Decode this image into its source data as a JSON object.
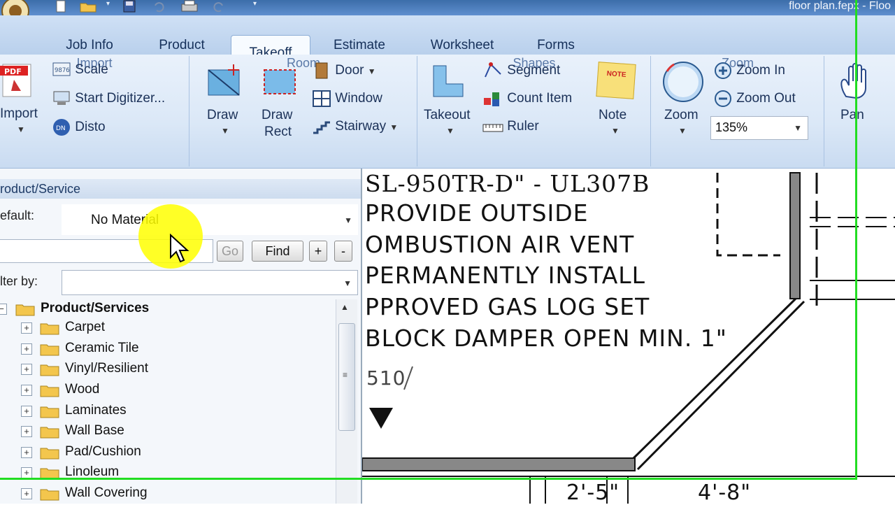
{
  "window": {
    "title": "floor plan.fepx - Floo"
  },
  "tabs": [
    {
      "label": "Job Info"
    },
    {
      "label": "Product"
    },
    {
      "label": "Takeoff"
    },
    {
      "label": "Estimate"
    },
    {
      "label": "Worksheet"
    },
    {
      "label": "Forms"
    }
  ],
  "ribbon": {
    "import_group": {
      "label": "Import",
      "import_button": "Import",
      "scale": "Scale",
      "start_digitizer": "Start Digitizer...",
      "disto": "Disto"
    },
    "room_group": {
      "label": "Room",
      "draw": "Draw",
      "draw_rect_line1": "Draw",
      "draw_rect_line2": "Rect",
      "door": "Door",
      "window": "Window",
      "stairway": "Stairway"
    },
    "shapes_group": {
      "label": "Shapes",
      "takeout": "Takeout",
      "segment": "Segment",
      "count_item": "Count Item",
      "ruler": "Ruler",
      "note": "Note",
      "note_icon_text": "NOTE"
    },
    "zoom_group": {
      "label": "Zoom",
      "zoom": "Zoom",
      "zoom_in": "Zoom In",
      "zoom_out": "Zoom Out",
      "zoom_level": "135%"
    },
    "pan_group": {
      "pan": "Pan"
    }
  },
  "left_panel": {
    "header": "roduct/Service",
    "default_label": "efault:",
    "default_value": "No Material",
    "go_button": "Go",
    "find_button": "Find",
    "add_button": "+",
    "remove_button": "-",
    "filter_label": "lter by:",
    "tree_root": "Product/Services",
    "tree_items": [
      {
        "label": "Carpet"
      },
      {
        "label": "Ceramic Tile"
      },
      {
        "label": "Vinyl/Resilient"
      },
      {
        "label": "Wood"
      },
      {
        "label": "Laminates"
      },
      {
        "label": "Wall Base"
      },
      {
        "label": "Pad/Cushion"
      },
      {
        "label": "Linoleum"
      },
      {
        "label": "Wall Covering"
      }
    ]
  },
  "canvas": {
    "lines": [
      "SL-950TR-D\" - UL307B",
      "PROVIDE OUTSIDE",
      "OMBUSTION AIR VENT",
      "PERMANENTLY INSTALL",
      "PPROVED GAS LOG SET",
      "BLOCK DAMPER OPEN MIN. 1\""
    ],
    "ref_tag": "510",
    "dim_1": "2'-5\"",
    "dim_2": "4'-8\""
  },
  "colors": {
    "highlight": "#22dd22",
    "cursor_highlight": "#ffff00"
  }
}
